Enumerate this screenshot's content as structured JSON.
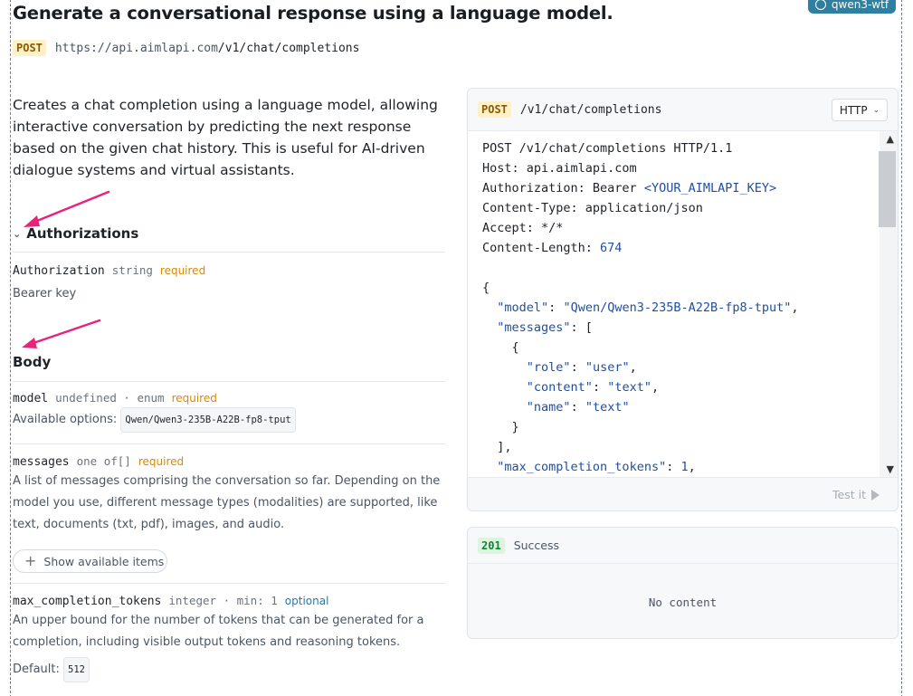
{
  "badge": {
    "label": "qwen3-wtf"
  },
  "page": {
    "title": "Generate a conversational response using a language model.",
    "method": "POST",
    "url_host": "https://api.aimlapi.com",
    "url_path": "/v1/chat/completions",
    "description": "Creates a chat completion using a language model, allowing interactive conversation by predicting the next response based on the given chat history. This is useful for AI-driven dialogue systems and virtual assistants."
  },
  "authorizations": {
    "heading": "Authorizations",
    "param": {
      "name": "Authorization",
      "type": "string",
      "flag": "required",
      "desc": "Bearer key"
    }
  },
  "body": {
    "heading": "Body",
    "params": {
      "model": {
        "name": "model",
        "type": "undefined · enum",
        "flag": "required",
        "options_label": "Available options:",
        "option": "Qwen/Qwen3-235B-A22B-fp8-tput"
      },
      "messages": {
        "name": "messages",
        "type": "one of[]",
        "flag": "required",
        "desc": "A list of messages comprising the conversation so far. Depending on the model you use, different message types (modalities) are supported, like text, documents (txt, pdf), images, and audio.",
        "show_button": "Show available items"
      },
      "max_completion_tokens": {
        "name": "max_completion_tokens",
        "type": "integer · min: 1",
        "flag": "optional",
        "desc": "An upper bound for the number of tokens that can be generated for a completion, including visible output tokens and reasoning tokens.",
        "default_label": "Default:",
        "default_value": "512"
      }
    }
  },
  "request_panel": {
    "method": "POST",
    "path": "/v1/chat/completions",
    "language": "HTTP",
    "lines": [
      "POST /v1/chat/completions HTTP/1.1",
      "Host: api.aimlapi.com",
      "Authorization: Bearer <YOUR_AIMLAPI_KEY>",
      "Content-Type: application/json",
      "Accept: */*",
      "Content-Length: 674",
      "",
      "{",
      "  \"model\": \"Qwen/Qwen3-235B-A22B-fp8-tput\",",
      "  \"messages\": [",
      "    {",
      "      \"role\": \"user\",",
      "      \"content\": \"text\",",
      "      \"name\": \"text\"",
      "    }",
      "  ],",
      "  \"max_completion_tokens\": 1,"
    ],
    "test_button": "Test it"
  },
  "response_panel": {
    "status_code": "201",
    "status_text": "Success",
    "body": "No content"
  },
  "colors": {
    "accent": "#2f7fa1",
    "arrow": "#e8237a",
    "required": "#d98a00",
    "optional": "#1f7ab0"
  }
}
